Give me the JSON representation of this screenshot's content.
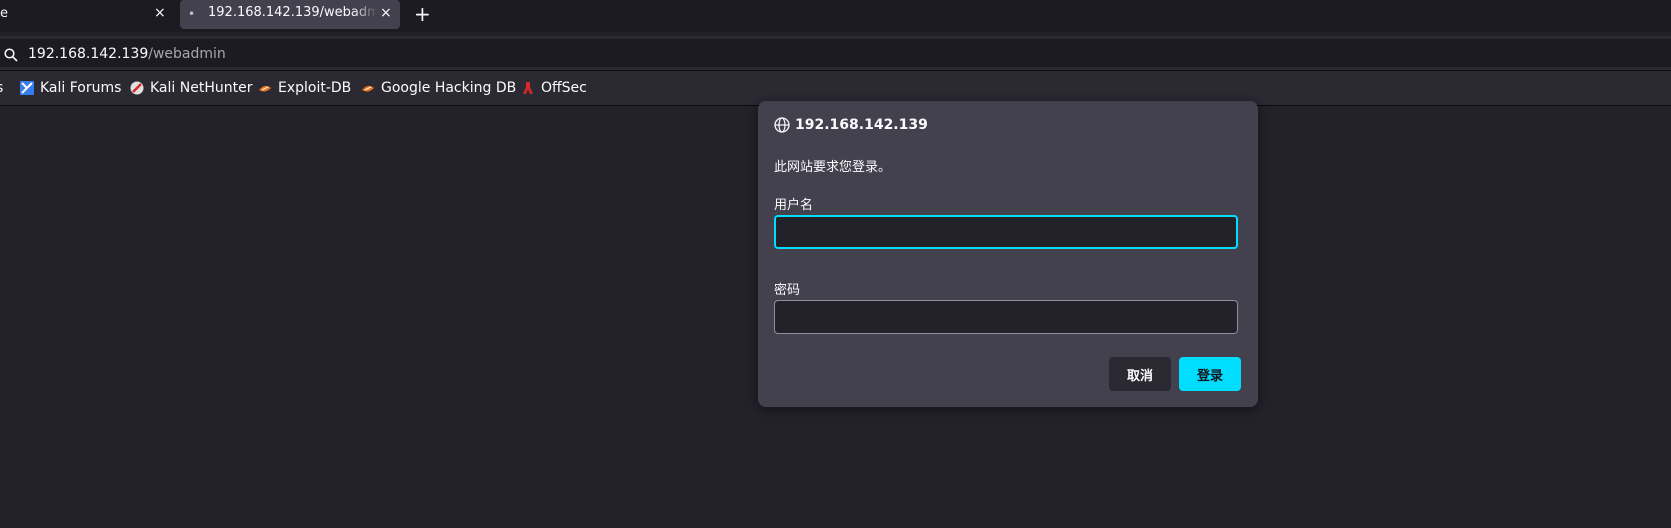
{
  "tabs": [
    {
      "label": "e",
      "close": "×"
    },
    {
      "label": "192.168.142.139/webadmin",
      "close": "×",
      "active": true
    }
  ],
  "new_tab": "+",
  "url": {
    "host": "192.168.142.139",
    "path": "/webadmin"
  },
  "bookmarks": [
    {
      "label": "s",
      "icon": "truncated-icon"
    },
    {
      "label": "Kali Forums",
      "icon": "kali-forums-icon"
    },
    {
      "label": "Kali NetHunter",
      "icon": "kali-nethunter-icon"
    },
    {
      "label": "Exploit-DB",
      "icon": "exploit-db-icon"
    },
    {
      "label": "Google Hacking DB",
      "icon": "ghdb-icon"
    },
    {
      "label": "OffSec",
      "icon": "offsec-icon"
    }
  ],
  "dialog": {
    "host": "192.168.142.139",
    "message": "此网站要求您登录。",
    "username_label": "用户名",
    "username_value": "",
    "password_label": "密码",
    "password_value": "",
    "cancel_label": "取消",
    "login_label": "登录"
  },
  "colors": {
    "accent": "#00ddff",
    "background": "#23222b",
    "dialog": "#42414d"
  }
}
